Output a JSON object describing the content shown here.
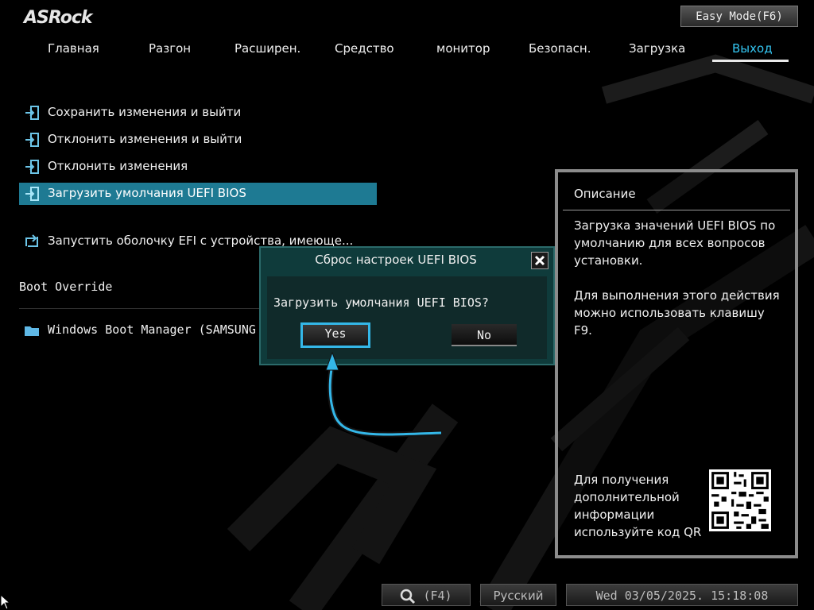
{
  "brand": "ASRock",
  "easy_mode_label": "Easy Mode(F6)",
  "nav": {
    "tabs": [
      {
        "label": "Главная"
      },
      {
        "label": "Разгон"
      },
      {
        "label": "Расширен."
      },
      {
        "label": "Средство"
      },
      {
        "label": "монитор"
      },
      {
        "label": "Безопасн."
      },
      {
        "label": "Загрузка"
      },
      {
        "label": "Выход",
        "active": true
      }
    ]
  },
  "menu": {
    "items": [
      {
        "label": "Сохранить изменения и выйти",
        "icon": "exit-door-icon"
      },
      {
        "label": "Отклонить изменения и выйти",
        "icon": "exit-door-icon"
      },
      {
        "label": "Отклонить изменения",
        "icon": "exit-door-icon"
      },
      {
        "label": "Загрузить умолчания UEFI BIOS",
        "icon": "exit-door-icon",
        "selected": true
      },
      {
        "label": "Запустить оболочку EFI с устройства, имеюще...",
        "icon": "launch-shell-icon"
      }
    ],
    "boot_override_label": "Boot Override",
    "boot_items": [
      {
        "label": "Windows Boot Manager (SAMSUNG MZVL",
        "icon": "folder-icon"
      }
    ]
  },
  "description": {
    "title": "Описание",
    "text": "Загрузка значений UEFI BIOS по умолчанию для всех вопросов установки.",
    "hotkey_text": "Для выполнения этого действия можно использовать клавишу F9.",
    "qr_text": "Для получения дополнительной информации используйте код QR"
  },
  "dialog": {
    "title": "Сброс настроек UEFI BIOS",
    "message": "Загрузить умолчания UEFI BIOS?",
    "yes_label": "Yes",
    "no_label": "No"
  },
  "footer": {
    "search_label": "(F4)",
    "language": "Русский",
    "datetime": "Wed 03/05/2025. 15:18:08"
  },
  "colors": {
    "accent": "#34c6f2",
    "selected_row": "#1e7a93",
    "dialog_bg": "#0f3b3b",
    "annotation_arrow": "#34b7e8"
  }
}
